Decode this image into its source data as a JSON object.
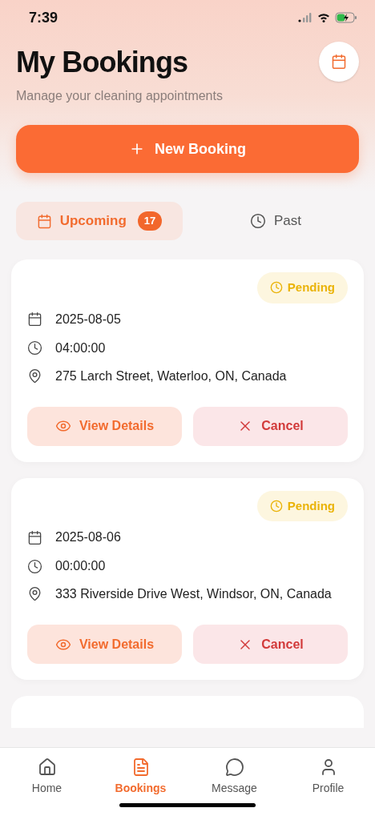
{
  "status_bar": {
    "time": "7:39"
  },
  "header": {
    "title": "My Bookings",
    "subtitle": "Manage your cleaning appointments"
  },
  "new_booking_button": {
    "label": "New Booking"
  },
  "tabs": [
    {
      "label": "Upcoming",
      "selected": true,
      "badge": "17"
    },
    {
      "label": "Past",
      "selected": false
    }
  ],
  "bookings": [
    {
      "status": "Pending",
      "date": "2025-08-05",
      "time": "04:00:00",
      "address": "275 Larch Street, Waterloo, ON, Canada",
      "view_label": "View Details",
      "cancel_label": "Cancel"
    },
    {
      "status": "Pending",
      "date": "2025-08-06",
      "time": "00:00:00",
      "address": "333 Riverside Drive West, Windsor, ON, Canada",
      "view_label": "View Details",
      "cancel_label": "Cancel"
    }
  ],
  "bottom_nav": [
    {
      "label": "Home",
      "selected": false,
      "kind": "home"
    },
    {
      "label": "Bookings",
      "selected": true,
      "kind": "bookings"
    },
    {
      "label": "Message",
      "selected": false,
      "kind": "message"
    },
    {
      "label": "Profile",
      "selected": false,
      "kind": "profile"
    }
  ]
}
